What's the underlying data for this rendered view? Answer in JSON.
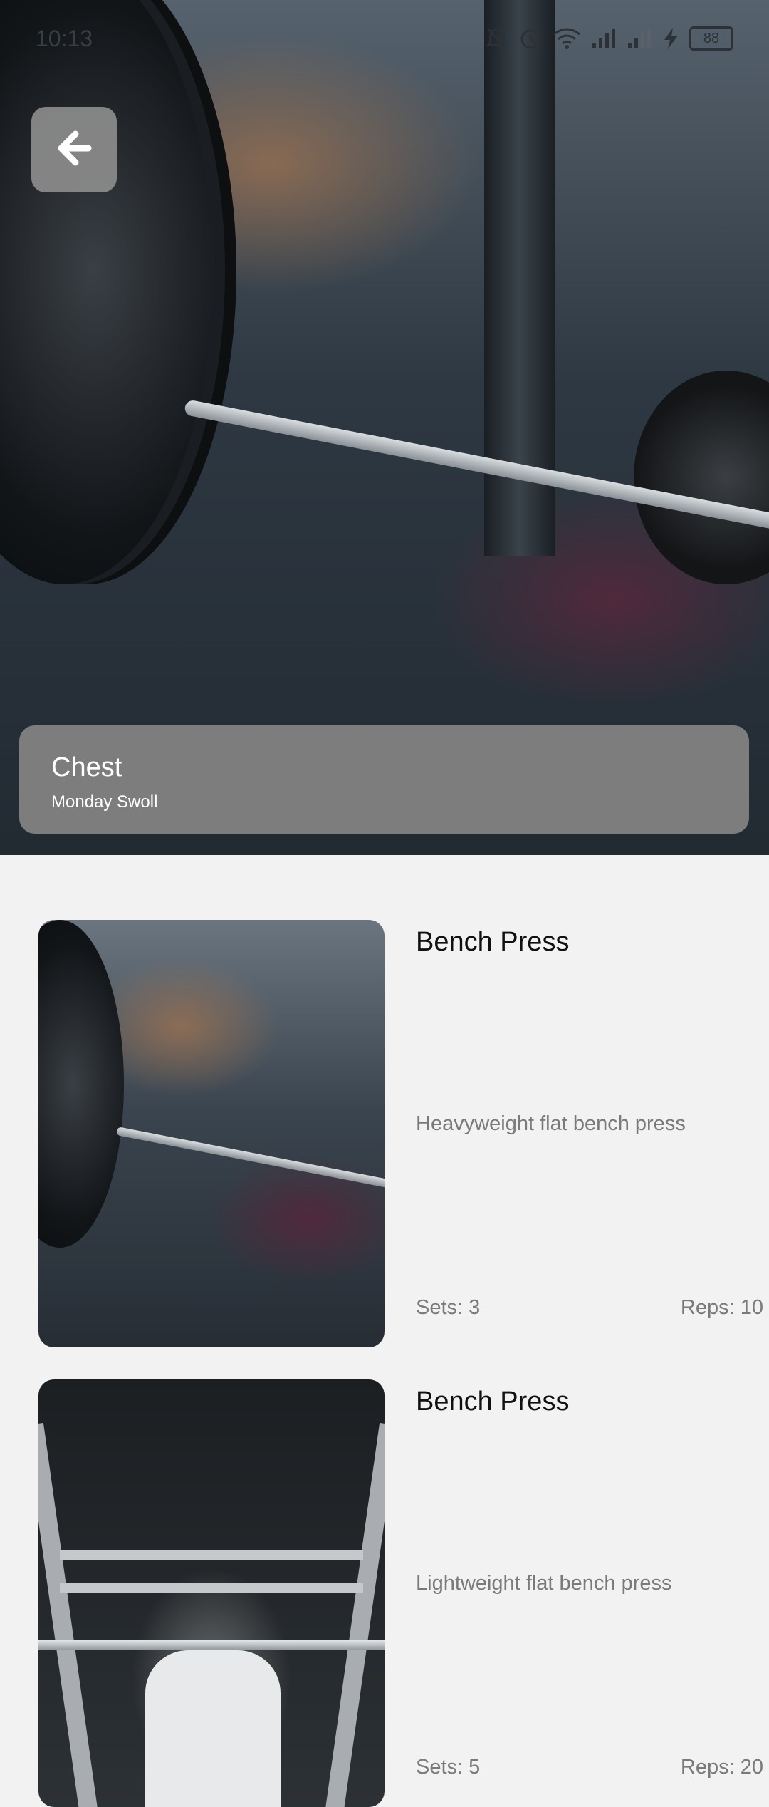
{
  "status_bar": {
    "time": "10:13",
    "battery": "88",
    "icons": [
      "mute-icon",
      "alarm-icon",
      "wifi-icon",
      "signal-icon",
      "signal-icon",
      "charging-icon",
      "battery-icon"
    ]
  },
  "header": {
    "back_icon": "arrow-left-icon",
    "title": "Chest",
    "subtitle": "Monday Swoll"
  },
  "exercises": [
    {
      "name": "Bench Press",
      "description": "Heavyweight flat bench press",
      "sets_label": "Sets: 3",
      "reps_label": "Reps: 10"
    },
    {
      "name": "Bench Press",
      "description": "Lightweight flat bench press",
      "sets_label": "Sets: 5",
      "reps_label": "Reps: 20"
    }
  ],
  "colors": {
    "page_background": "#f2f2f2",
    "title_card": "#7d7d7d",
    "back_button": "#8c8c8c",
    "primary_text": "#111111",
    "secondary_text": "#7a7a7a"
  }
}
